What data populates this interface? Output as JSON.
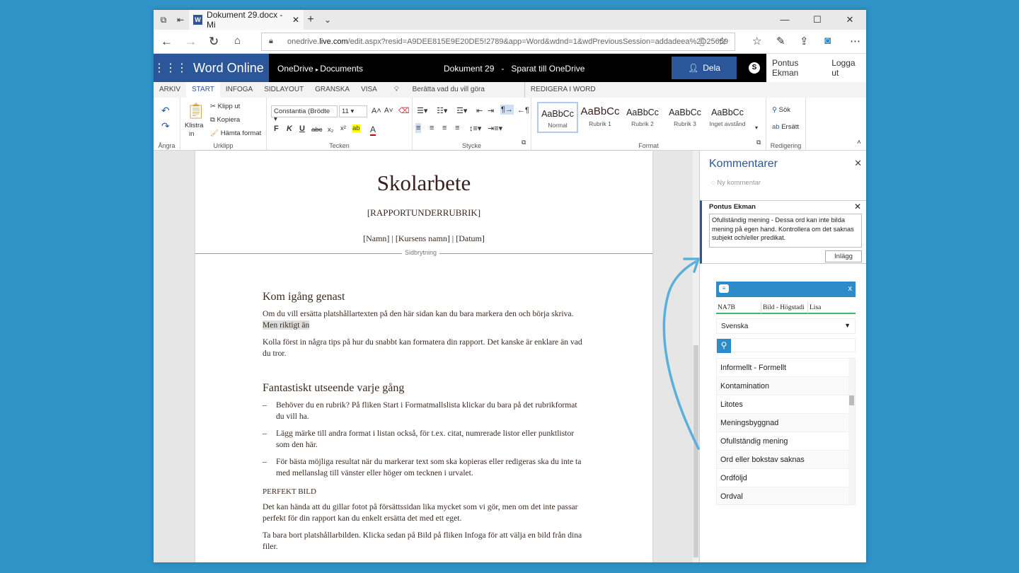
{
  "browser": {
    "tab_title": "Dokument 29.docx - Mi",
    "url_prefix": "onedrive.",
    "url_domain": "live.com",
    "url_rest": "/edit.aspx?resid=A9DEE815E9E20DE5!2789&app=Word&wdnd=1&wdPreviousSession=addadeea%2D25659"
  },
  "word": {
    "app_name": "Word Online",
    "breadcrumb_root": "OneDrive",
    "breadcrumb_folder": "Documents",
    "doc_title": "Dokument 29",
    "save_status": "Sparat till OneDrive",
    "share_label": "Dela",
    "user_name": "Pontus Ekman",
    "logout_label": "Logga ut"
  },
  "ribbon_tabs": [
    "ARKIV",
    "START",
    "INFOGA",
    "SIDLAYOUT",
    "GRANSKA",
    "VISA"
  ],
  "tell_me": "Berätta vad du vill göra",
  "edit_in_word": "REDIGERA I WORD",
  "ribbon": {
    "undo_group": "Ångra",
    "paste_label": "Klistra",
    "paste_label2": "in",
    "cut": "Klipp ut",
    "copy": "Kopiera",
    "format_painter": "Hämta format",
    "clipboard_group": "Urklipp",
    "font_name": "Constantia (Brödte",
    "font_size": "11",
    "font_group": "Tecken",
    "paragraph_group": "Stycke",
    "styles": [
      {
        "preview": "AaBbCc",
        "name": "Normal"
      },
      {
        "preview": "AaBbCc",
        "name": "Rubrik 1"
      },
      {
        "preview": "AaBbCc",
        "name": "Rubrik 2"
      },
      {
        "preview": "AaBbCc",
        "name": "Rubrik 3"
      },
      {
        "preview": "AaBbCc",
        "name": "Inget avstånd"
      }
    ],
    "styles_group": "Format",
    "find": "Sök",
    "replace": "Ersätt",
    "editing_group": "Redigering"
  },
  "document": {
    "title": "Skolarbete",
    "subtitle": "[RAPPORTUNDERRUBRIK]",
    "meta": "[Namn] | [Kursens namn] | [Datum]",
    "page_break": "Sidbrytning",
    "h_start": "Kom igång genast",
    "p1_a": "Om du vill ersätta platshållartexten på den här sidan kan du bara markera den och börja skriva. ",
    "p1_b": "Men riktigt än",
    "p2": "Kolla först in några tips på hur du snabbt kan formatera din rapport. Det kanske är enklare än vad du tror.",
    "h_look": "Fantastiskt utseende varje gång",
    "bullets": [
      "Behöver du en rubrik? På fliken Start i Formatmallslista klickar du bara på det rubrikformat du vill ha.",
      "Lägg märke till andra format i listan också, för t.ex. citat, numrerade listor eller punktlistor som den här.",
      "För bästa möjliga resultat när du markerar text som ska kopieras eller redigeras ska du inte ta med mellanslag till vänster eller höger om tecknen i urvalet."
    ],
    "h_picture": "PERFEKT BILD",
    "p3": "Det kan hända att du gillar fotot på försättssidan lika mycket som vi gör, men om det inte passar perfekt för din rapport kan du enkelt ersätta det med ett eget.",
    "p4": "Ta bara bort platshållarbilden. Klicka sedan på Bild på fliken Infoga för att välja en bild från dina filer."
  },
  "comments": {
    "title": "Kommentarer",
    "new_comment": "Ny kommentar",
    "author": "Pontus Ekman",
    "text": "Ofullständig mening - Dessa ord kan inte bilda mening på egen hand. Kontrollera om det saknas subjekt och/eller predikat.",
    "post": "Inlägg"
  },
  "addin": {
    "columns": [
      "NA7B",
      "Bild - Högstadi",
      "Lisa"
    ],
    "language": "Svenska",
    "close": "x",
    "items": [
      "Informellt - Formellt",
      "Kontamination",
      "Litotes",
      "Meningsbyggnad",
      "Ofullständig mening",
      "Ord eller bokstav saknas",
      "Ordföljd",
      "Ordval"
    ]
  },
  "colors": {
    "word_blue": "#2b579a",
    "desktop": "#2f93c8",
    "addin_blue": "#2e8bc9",
    "addin_green": "#3db86b"
  }
}
